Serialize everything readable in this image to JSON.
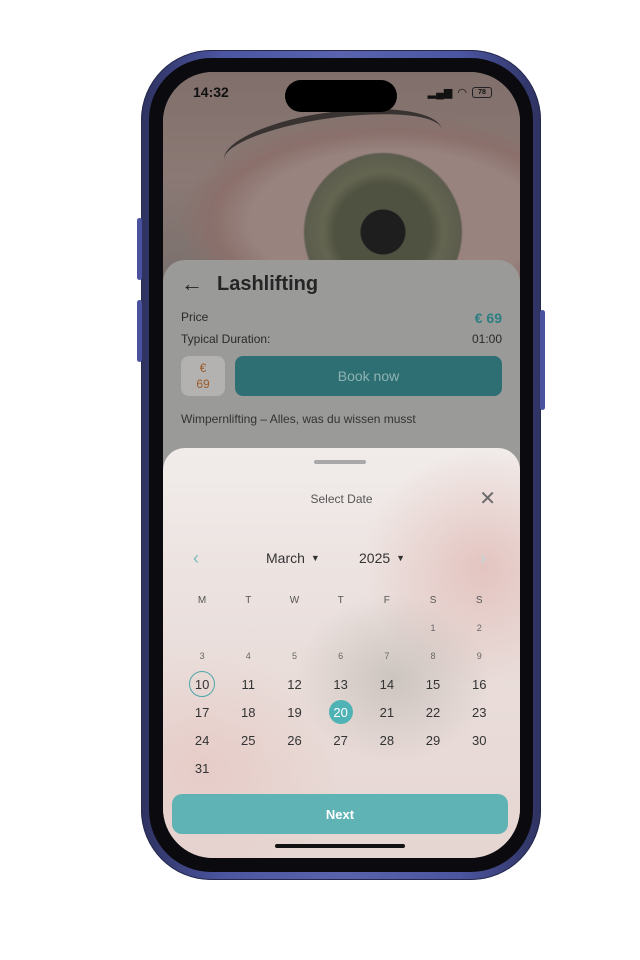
{
  "status_bar": {
    "time": "14:32",
    "battery": "78"
  },
  "service": {
    "title": "Lashlifting",
    "price_label": "Price",
    "price_value": "€ 69",
    "duration_label": "Typical Duration:",
    "duration_value": "01:00",
    "price_chip_currency": "€",
    "price_chip_amount": "69",
    "book_label": "Book now",
    "description": "Wimpernlifting – Alles, was du wissen musst"
  },
  "date_sheet": {
    "title": "Select Date",
    "month": "March",
    "year": "2025",
    "weekdays": [
      "M",
      "T",
      "W",
      "T",
      "F",
      "S",
      "S"
    ],
    "weeks": [
      [
        "",
        "",
        "",
        "",
        "",
        "1",
        "2"
      ],
      [
        "3",
        "4",
        "5",
        "6",
        "7",
        "8",
        "9"
      ],
      [
        "10",
        "11",
        "12",
        "13",
        "14",
        "15",
        "16"
      ],
      [
        "17",
        "18",
        "19",
        "20",
        "21",
        "22",
        "23"
      ],
      [
        "24",
        "25",
        "26",
        "27",
        "28",
        "29",
        "30"
      ],
      [
        "31",
        "",
        "",
        "",
        "",
        "",
        ""
      ]
    ],
    "today": "10",
    "selected": "20",
    "next_label": "Next"
  },
  "colors": {
    "accent": "#5fb3b5",
    "frame": "#4b55a0"
  }
}
